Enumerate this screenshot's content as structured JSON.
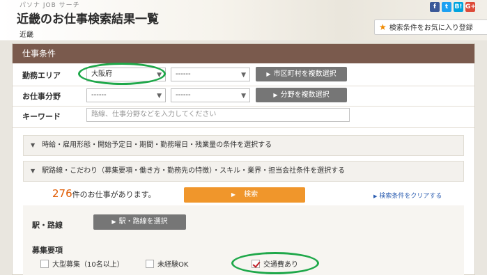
{
  "header": {
    "brand": "パソナ JOB サーチ",
    "title": "近畿のお仕事検索結果一覧",
    "area": "近畿",
    "fav_button": "検索条件をお気に入り登録"
  },
  "social": [
    {
      "label": "f",
      "color": "#3b5998"
    },
    {
      "label": "t",
      "color": "#1da1f2"
    },
    {
      "label": "B!",
      "color": "#00a4de"
    },
    {
      "label": "G+",
      "color": "#dd4b39"
    }
  ],
  "conditions": {
    "heading": "仕事条件",
    "work_area": {
      "label": "勤務エリア",
      "prefecture": "大阪府",
      "city": "------",
      "button": "市区町村を複数選択"
    },
    "job_field": {
      "label": "お仕事分野",
      "select1": "------",
      "select2": "------",
      "button": "分野を複数選択"
    },
    "keyword": {
      "label": "キーワード",
      "placeholder": "路線、仕事分野などを入力してください"
    },
    "accordion1": "時給・雇用形態・開始予定日・期間・勤務曜日・残業量の条件を選択する",
    "accordion2": "駅路線・こだわり（募集要項・働き方・勤務先の特徴）・スキル・業界・担当会社条件を選択する"
  },
  "results": {
    "count": "276",
    "count_suffix": "件のお仕事があります。",
    "search_button": "検索",
    "clear_link": "検索条件をクリアする"
  },
  "station": {
    "label": "駅・路線",
    "button": "駅・路線を選択"
  },
  "recruit": {
    "label": "募集要項",
    "options": [
      {
        "label": "大型募集（10名以上）",
        "checked": false
      },
      {
        "label": "未経験OK",
        "checked": false
      },
      {
        "label": "交通費あり",
        "checked": true
      }
    ]
  }
}
